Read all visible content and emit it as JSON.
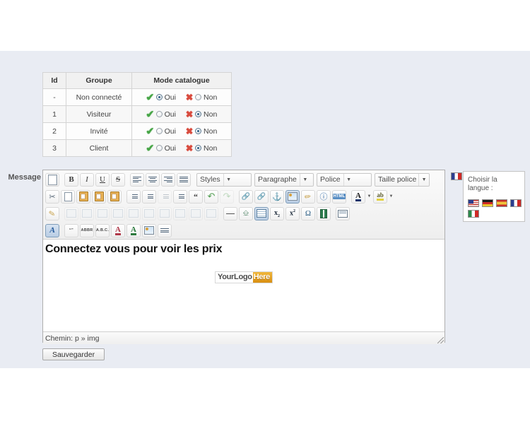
{
  "groups_table": {
    "headers": [
      "Id",
      "Groupe",
      "Mode catalogue"
    ],
    "yes_label": "Oui",
    "no_label": "Non",
    "rows": [
      {
        "id": "-",
        "groupe": "Non connecté",
        "mode": "oui"
      },
      {
        "id": "1",
        "groupe": "Visiteur",
        "mode": "non"
      },
      {
        "id": "2",
        "groupe": "Invité",
        "mode": "non"
      },
      {
        "id": "3",
        "groupe": "Client",
        "mode": "non"
      }
    ]
  },
  "form": {
    "message_label": "Message",
    "save_label": "Sauvegarder"
  },
  "editor": {
    "selects": {
      "styles": "Styles",
      "paragraph": "Paragraphe",
      "font": "Police",
      "fontsize": "Taille police"
    },
    "content": {
      "headline": "Connectez vous pour voir les prix",
      "logo_first": "YourLogo",
      "logo_second": "Here"
    },
    "statusbar": "Chemin: p » img"
  },
  "language_panel": {
    "title": "Choisir la langue :",
    "flags": [
      "us",
      "de",
      "es",
      "fr",
      "it"
    ],
    "current": "fr"
  },
  "colors": {
    "page_band": "#e9ecf3",
    "check_green": "#46a546",
    "cross_red": "#d84a3d",
    "logo_accent": "#d98f12"
  }
}
